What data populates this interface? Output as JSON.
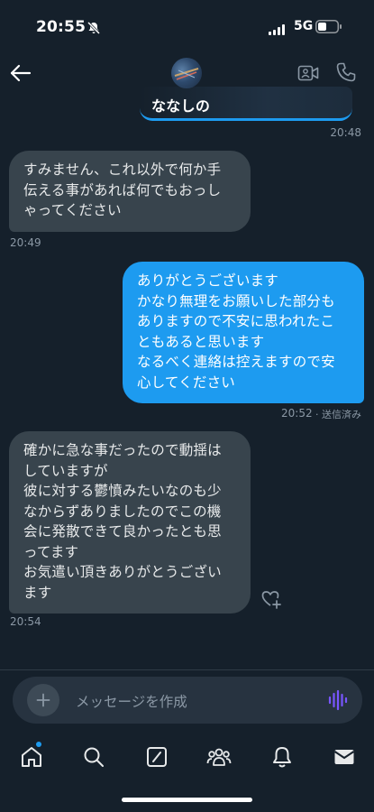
{
  "status_bar": {
    "time": "20:55",
    "network": "5G",
    "icons": [
      "bell-off-icon",
      "signal-icon",
      "battery-icon"
    ]
  },
  "header": {
    "name": "ななしの",
    "icons": [
      "back-arrow-icon",
      "video-call-icon",
      "phone-call-icon"
    ]
  },
  "messages": [
    {
      "direction": "received",
      "lines": [
        "すみません、これ以外で何か手",
        "伝える事があれば何でもおっし",
        "ゃってください"
      ],
      "time": "20:49"
    },
    {
      "direction": "sent",
      "lines": [
        "ありがとうございます",
        "かなり無理をお願いした部分も",
        "ありますので不安に思われたこ",
        "ともあると思います",
        "なるべく連絡は控えますので安",
        "心してください"
      ],
      "time": "20:52",
      "status": "· 送信済み"
    },
    {
      "direction": "received",
      "lines": [
        "確かに急な事だったので動揺は",
        "していますが",
        "彼に対する鬱憤みたいなのも少",
        "なからずありましたのでこの機",
        "会に発散できて良かったとも思",
        "ってます",
        "お気遣い頂きありがとうござい",
        "ます"
      ],
      "time": "20:54"
    }
  ],
  "earlier_time": "20:48",
  "composer": {
    "placeholder": "メッセージを作成"
  },
  "tab_bar": {
    "tabs": [
      "home-icon",
      "search-icon",
      "grok-icon",
      "communities-icon",
      "notifications-icon",
      "messages-icon"
    ]
  },
  "colors": {
    "background": "#15202b",
    "sent_bubble": "#1d9bf0",
    "received_bubble": "#38444d",
    "muted_text": "#8b98a5",
    "voice_icon": "#7856ff"
  }
}
